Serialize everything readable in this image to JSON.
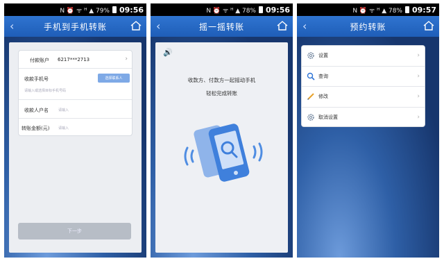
{
  "screens": [
    {
      "status": {
        "icons": "N ⏰ ᯤ ᴴ ▲ 79%",
        "time": "09:56"
      },
      "title": "手机到手机转账",
      "form": {
        "account_label": "付款账户",
        "account_value": "6217***2713",
        "phone_label": "收款手机号",
        "phone_placeholder": "请输入或选择目标手机号码",
        "pick_contact": "选择联系人",
        "name_label": "收款人户名",
        "name_placeholder": "请输入",
        "amount_label": "转账金额(元)",
        "amount_placeholder": "请输入"
      },
      "next_button": "下一步"
    },
    {
      "status": {
        "icons": "N ⏰ ᯤ ᴴ ▲ 78%",
        "time": "09:56"
      },
      "title": "摇一摇转账",
      "instruction_line1": "收款方、付款方一起摇动手机",
      "instruction_line2": "轻松完成转账"
    },
    {
      "status": {
        "icons": "N ⏰ ᯤ ᴴ ▲ 78%",
        "time": "09:57"
      },
      "title": "预约转账",
      "menu": [
        {
          "label": "设置",
          "icon": "gear-icon"
        },
        {
          "label": "查询",
          "icon": "search-icon"
        },
        {
          "label": "修改",
          "icon": "pencil-icon"
        },
        {
          "label": "取消设置",
          "icon": "gear-cancel-icon"
        }
      ]
    }
  ],
  "colors": {
    "title_bar": "#2f74d0",
    "accent": "#2d73d6",
    "button_disabled": "#b7bdc6"
  }
}
